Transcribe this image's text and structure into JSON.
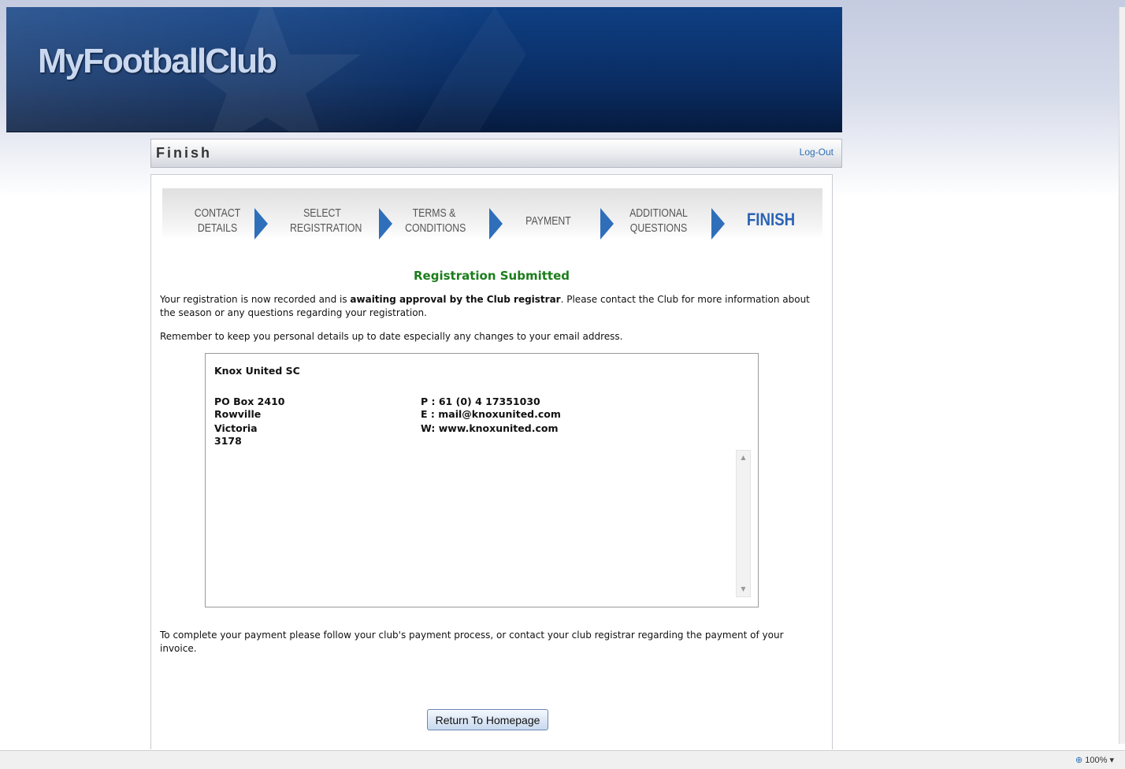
{
  "brand": {
    "logo_text": "MyFootballClub"
  },
  "titlebar": {
    "title": "Finish",
    "logout": "Log-Out"
  },
  "steps": [
    {
      "label_line1": "Contact",
      "label_line2": "Details"
    },
    {
      "label_line1": "Select",
      "label_line2": "Registration"
    },
    {
      "label_line1": "Terms &",
      "label_line2": "Conditions"
    },
    {
      "label_line1": "Payment",
      "label_line2": ""
    },
    {
      "label_line1": "Additional",
      "label_line2": "Questions"
    },
    {
      "label_line1": "Finish",
      "label_line2": ""
    }
  ],
  "main": {
    "heading": "Registration Submitted",
    "intro_before": "Your registration is now recorded and is ",
    "intro_bold": "awaiting approval by the Club registrar",
    "intro_after": ". Please contact the Club for more information about the season or any questions regarding your registration.",
    "reminder": "Remember to keep you personal details up to date especially any changes to your email address.",
    "payment_note": "To complete your payment please follow your club's payment process, or contact your club registrar regarding the payment of your invoice.",
    "return_button": "Return To Homepage"
  },
  "club": {
    "name": "Knox United SC",
    "address_line1": "PO Box 2410",
    "address_line2": "Rowville",
    "address_line3": "Victoria",
    "address_line4": "3178",
    "phone": "P : 61 (0) 4 17351030",
    "email": "E : mail@knoxunited.com",
    "web": "W: www.knoxunited.com"
  },
  "statusbar": {
    "zoom": "100%"
  },
  "colors": {
    "banner": "#0a2d63",
    "heading_green": "#1b7d1b",
    "step_arrow": "#2f6fba",
    "finish_blue": "#2a63b5"
  }
}
